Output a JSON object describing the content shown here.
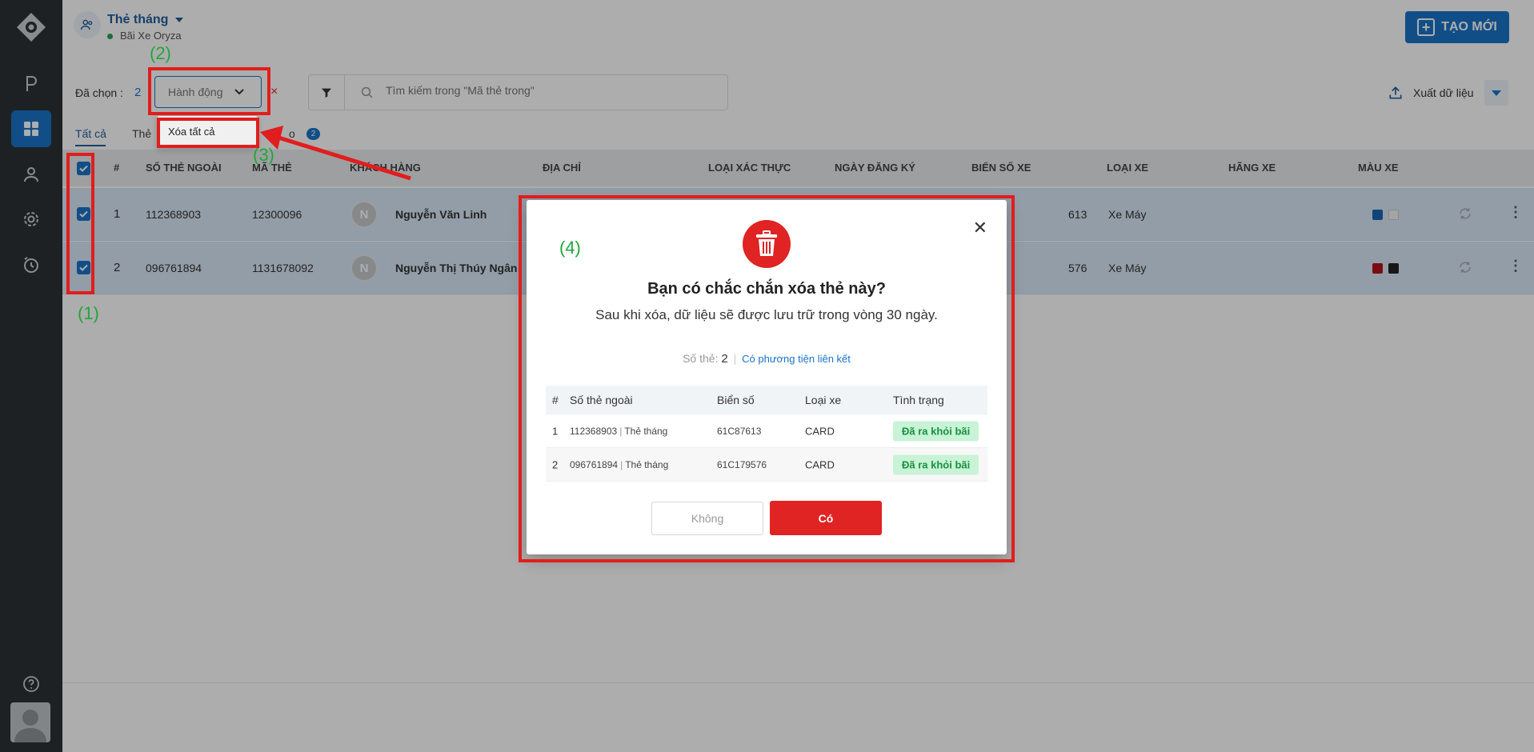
{
  "header": {
    "title": "Thẻ tháng",
    "subtitle": "Bãi Xe Oryza",
    "create_label": "TẠO MỚI"
  },
  "toolbar": {
    "selected_label": "Đã chọn :",
    "selected_count": "2",
    "action_label": "Hành động",
    "clear": "×",
    "search_placeholder": "Tìm kiếm trong \"Mã thẻ trong\"",
    "export_label": "Xuất dữ liệu"
  },
  "tabs": [
    {
      "label": "Tất cả"
    },
    {
      "label": "Thẻ"
    },
    {
      "label": "o"
    }
  ],
  "tab_badge": "2",
  "dropdown": {
    "item": "Xóa tất cả"
  },
  "table": {
    "columns": [
      "#",
      "SỐ THẺ NGOÀI",
      "MÃ THẺ",
      "KHÁCH HÀNG",
      "ĐỊA CHỈ",
      "LOẠI XÁC THỰC",
      "NGÀY ĐĂNG KÝ",
      "BIỂN SỐ XE",
      "LOẠI XE",
      "HÃNG XE",
      "MÀU XE"
    ],
    "rows": [
      {
        "index": "1",
        "external_card": "112368903",
        "card_code": "12300096",
        "avatar": "N",
        "customer": "Nguyễn Văn Linh",
        "plate_partial": "613",
        "vehicle_type": "Xe Máy",
        "colors": [
          "#1a66b3",
          "#f2f2f2"
        ]
      },
      {
        "index": "2",
        "external_card": "096761894",
        "card_code": "1131678092",
        "avatar": "N",
        "customer": "Nguyễn Thị Thúy Ngân",
        "plate_partial": "576",
        "vehicle_type": "Xe Máy",
        "colors": [
          "#b3141a",
          "#222222"
        ]
      }
    ]
  },
  "modal": {
    "title": "Bạn có chắc chắn xóa thẻ này?",
    "subtitle": "Sau khi xóa, dữ liệu sẽ được lưu trữ trong vòng 30 ngày.",
    "count_label": "Số thẻ:",
    "count_value": "2",
    "count_link": "Có phương tiện liên kết",
    "columns": [
      "#",
      "Số thẻ ngoài",
      "Biển số",
      "Loại xe",
      "Tình trạng"
    ],
    "rows": [
      {
        "index": "1",
        "card": "112368903",
        "card_type": "Thẻ tháng",
        "plate": "61C87613",
        "type": "CARD",
        "status": "Đã ra khỏi bãi"
      },
      {
        "index": "2",
        "card": "096761894",
        "card_type": "Thẻ tháng",
        "plate": "61C179576",
        "type": "CARD",
        "status": "Đã ra khỏi bãi"
      }
    ],
    "no_label": "Không",
    "yes_label": "Có"
  },
  "annotations": {
    "label_1": "(1)",
    "label_2": "(2)",
    "label_3": "(3)",
    "label_4": "(4)"
  },
  "colors": {
    "sidebar": "#2d3236",
    "primary": "#1a74c7",
    "danger": "#e02323",
    "annotation_red": "#e21d1d",
    "annotation_green": "#1fa83b",
    "status_bg": "#c9f3d7"
  }
}
